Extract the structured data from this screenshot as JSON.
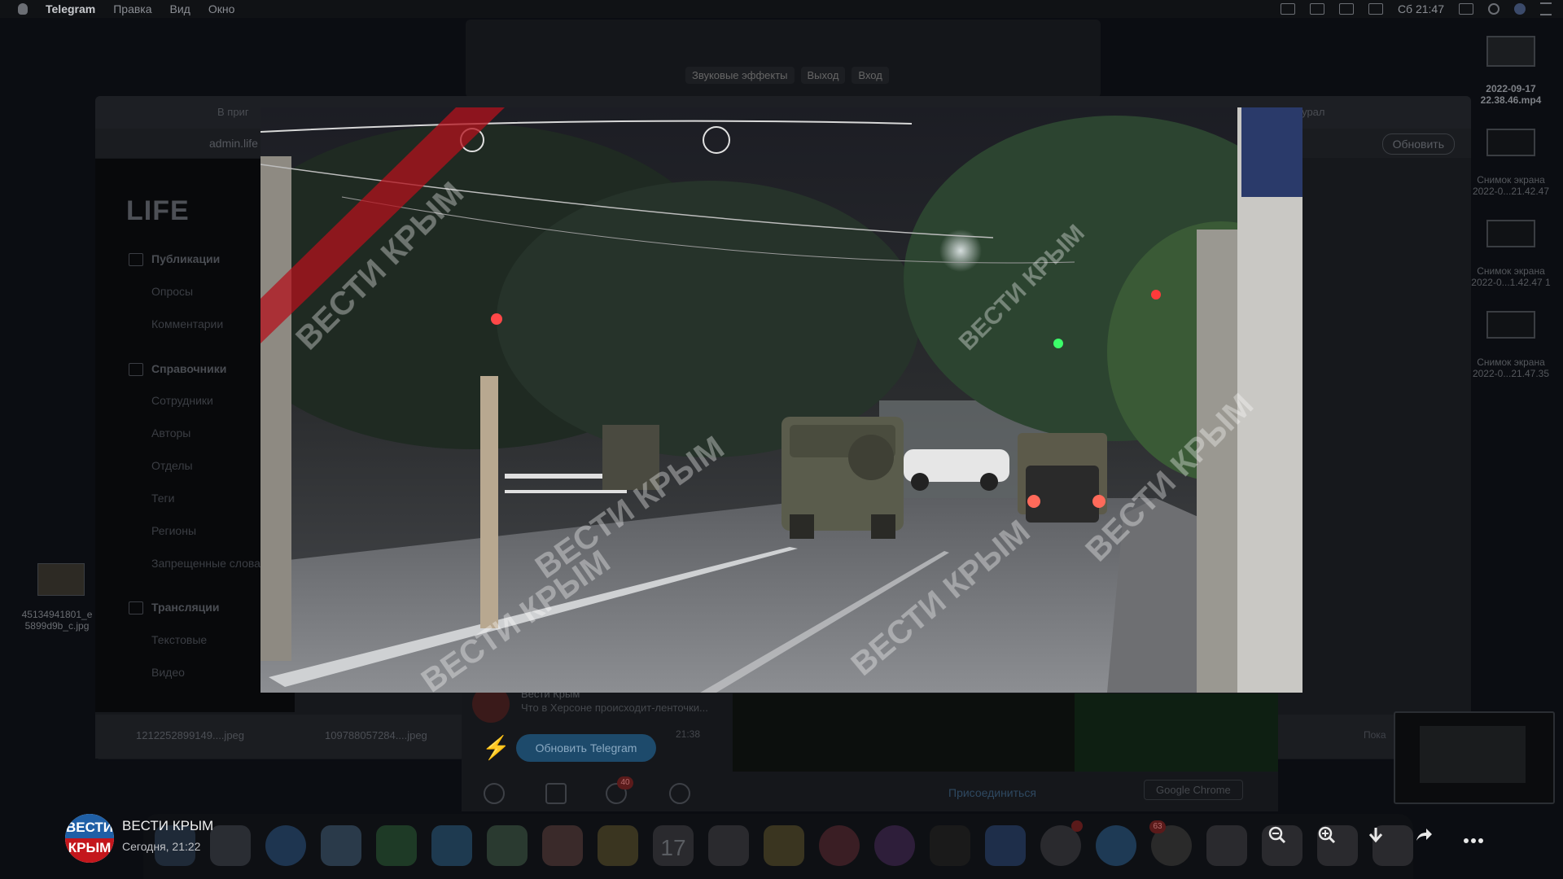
{
  "menubar": {
    "apple": "",
    "app": "Telegram",
    "items": [
      "Правка",
      "Вид",
      "Окно"
    ],
    "clock": "Сб 21:47"
  },
  "telegram_bg": {
    "toolbar": [
      "Звуковые эффекты",
      "Выход",
      "Вход"
    ]
  },
  "chrome_bg": {
    "tab_left": "В приг",
    "tab_right": "мурал",
    "url": "admin.life",
    "update_button": "Обновить",
    "downloads": [
      "1212252899149....jpeg",
      "109788057284....jpeg"
    ],
    "show_all": "Пока"
  },
  "life_admin": {
    "logo": "LIFE",
    "items": [
      {
        "label": "Публикации",
        "head": true
      },
      {
        "label": "Опросы",
        "head": false
      },
      {
        "label": "Комментарии",
        "head": false
      },
      {
        "label": "Справочники",
        "head": true
      },
      {
        "label": "Сотрудники",
        "head": false
      },
      {
        "label": "Авторы",
        "head": false
      },
      {
        "label": "Отделы",
        "head": false
      },
      {
        "label": "Теги",
        "head": false
      },
      {
        "label": "Регионы",
        "head": false
      },
      {
        "label": "Запрещенные слова",
        "head": false
      },
      {
        "label": "Трансляции",
        "head": true
      },
      {
        "label": "Текстовые",
        "head": false
      },
      {
        "label": "Видео",
        "head": false
      }
    ]
  },
  "tg_chat_bg": {
    "name": "Вести Крым",
    "snippet": "Что в Херсоне происходит-ленточки...",
    "time": "21:38",
    "update_button": "Обновить Telegram",
    "join": "Присоединиться",
    "chrome_button": "Google Chrome",
    "badge": "40"
  },
  "desktop": {
    "right_items": [
      {
        "label": "2022-09-17 22.38.46.mp4"
      },
      {
        "label": "Снимок экрана 2022-0...21.42.47"
      },
      {
        "label": "Снимок экрана 2022-0...1.42.47 1"
      },
      {
        "label": "Снимок экрана 2022-0...21.47.35"
      }
    ],
    "left_item": "45134941801_e 5899d9b_c.jpg"
  },
  "dock": {
    "calendar_day": "17",
    "telegram_badge": "63"
  },
  "viewer": {
    "channel": "ВЕСТИ КРЫМ",
    "date": "Сегодня, 21:22",
    "avatar_top": "ВЕСТИ",
    "avatar_bottom": "КРЫМ",
    "watermark": "ВЕСТИ КРЫМ",
    "buttons": [
      "zoom-out-icon",
      "zoom-in-icon",
      "download-icon",
      "share-icon",
      "more-icon"
    ]
  },
  "colors": {
    "accent_blue": "#1f5fa6",
    "accent_red": "#c4161c"
  }
}
